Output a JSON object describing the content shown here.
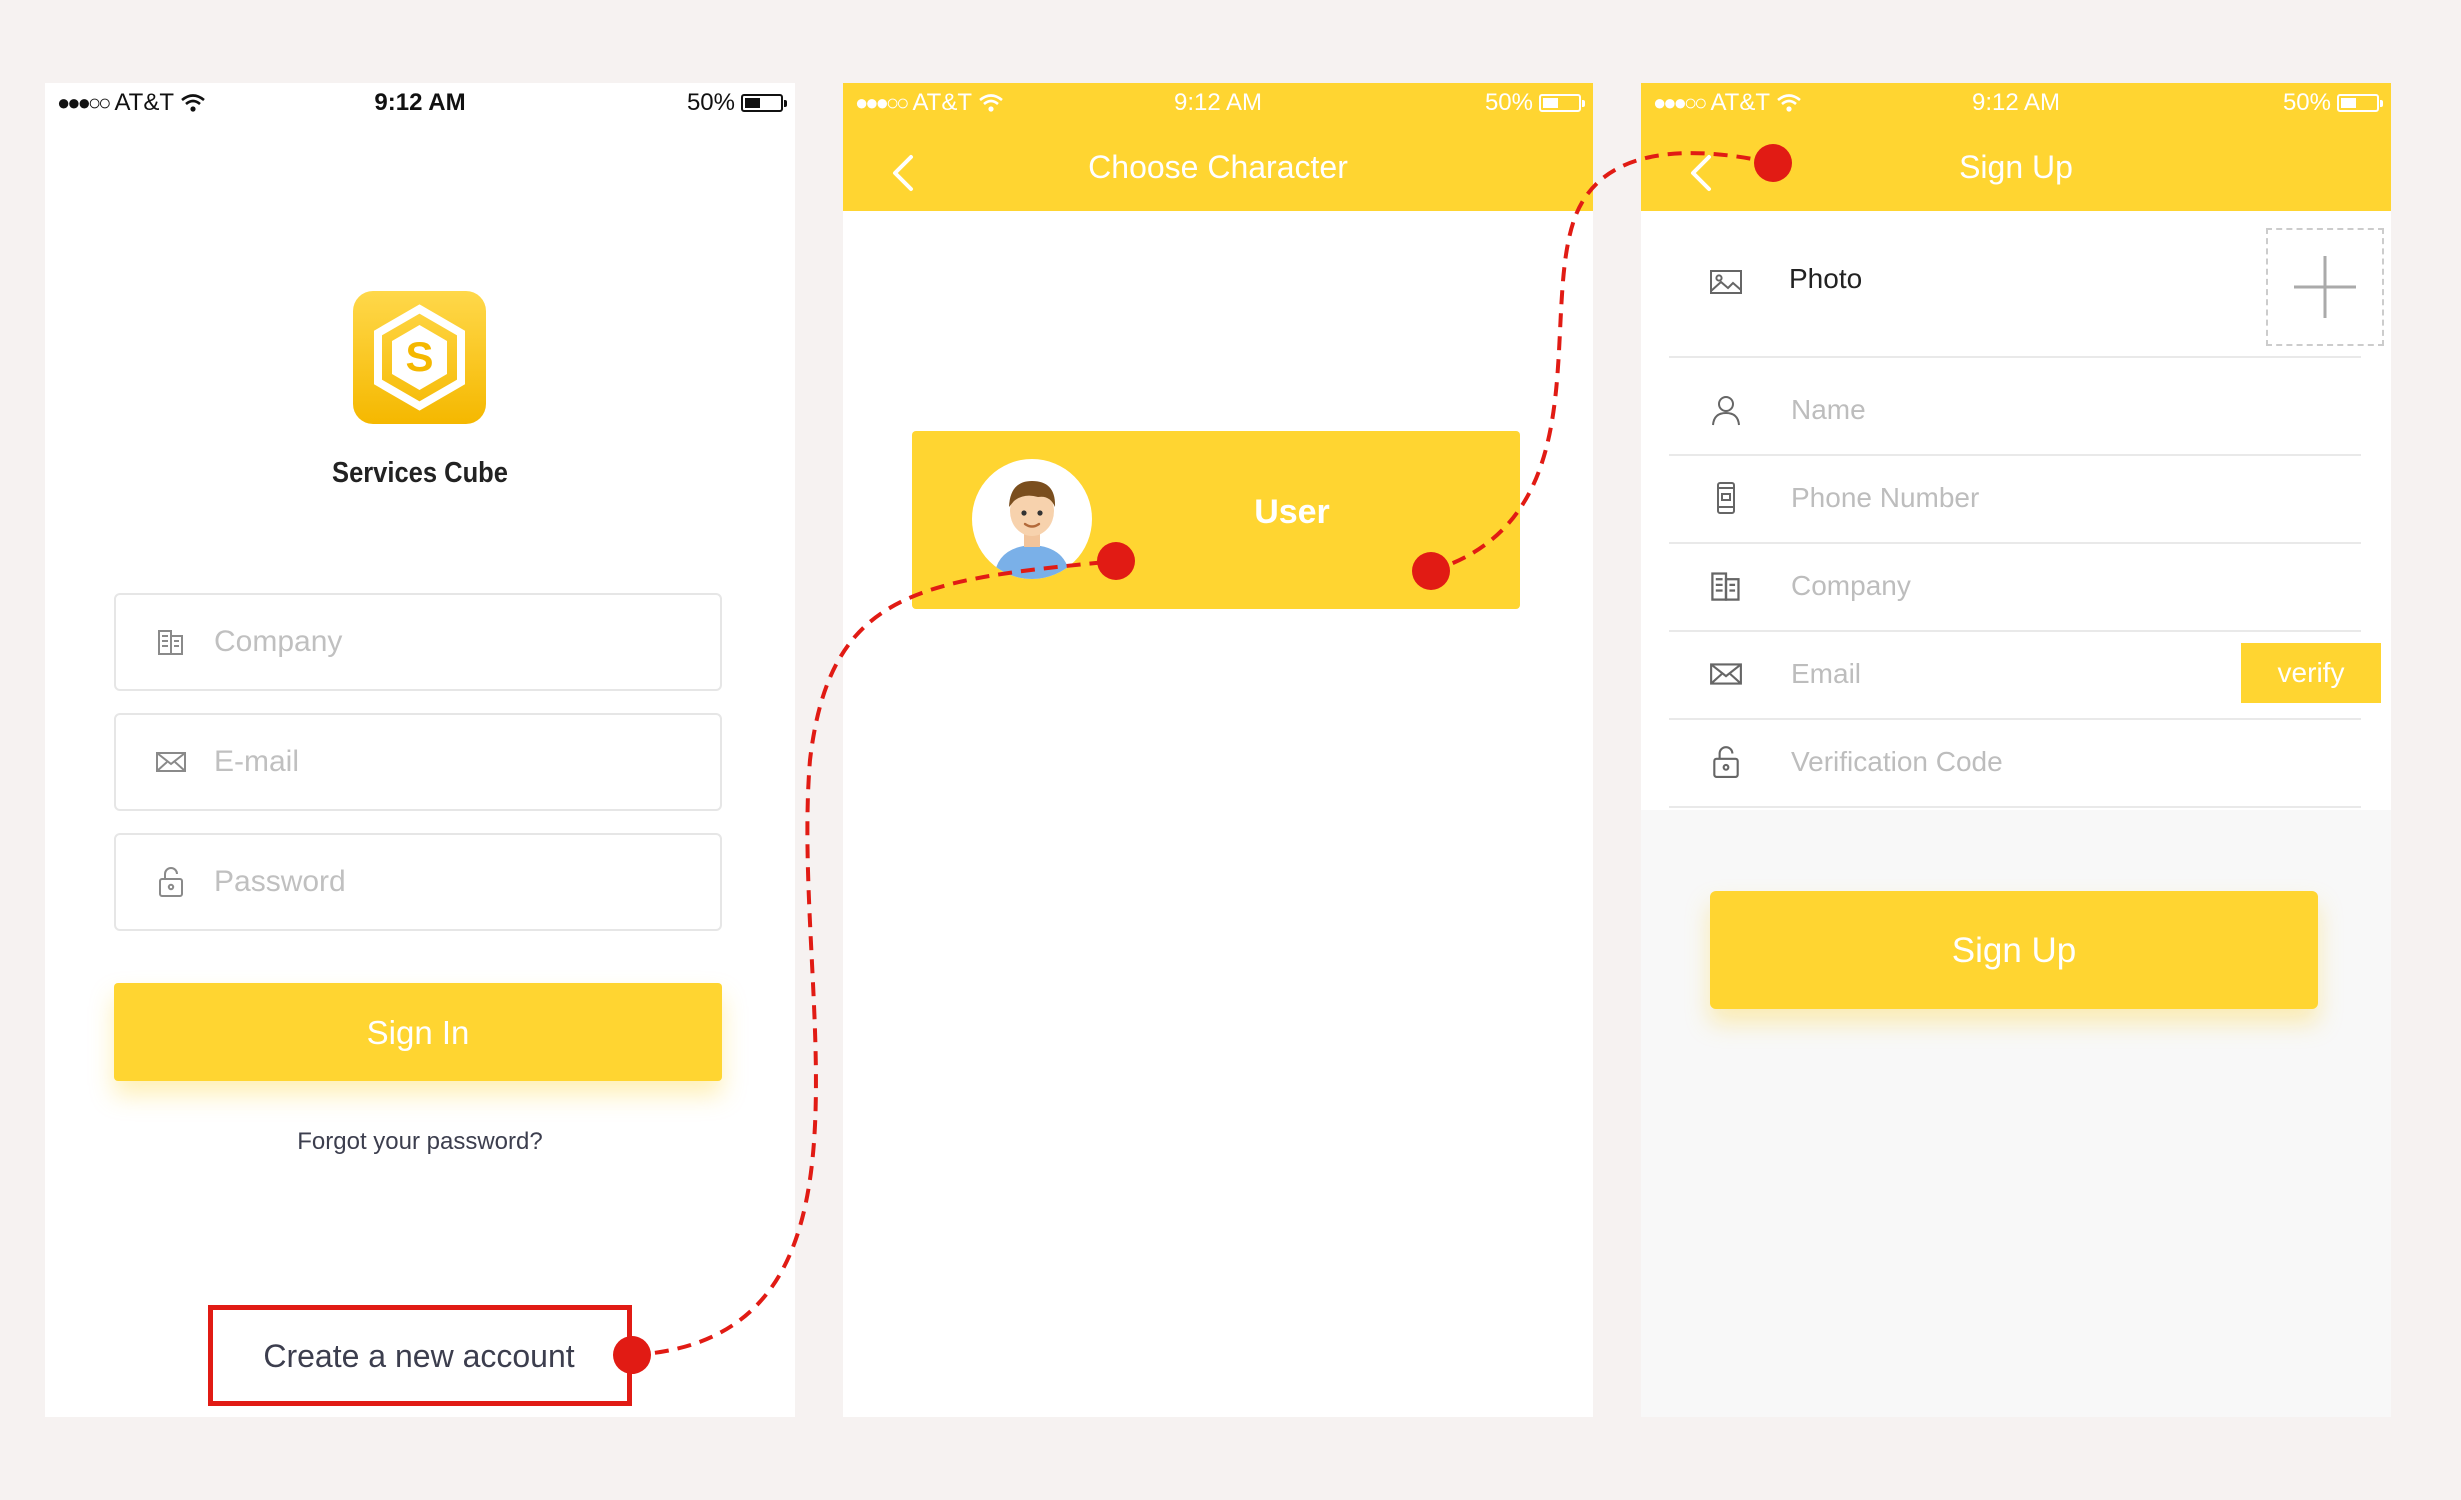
{
  "status_bar": {
    "carrier": "AT&T",
    "time": "9:12 AM",
    "battery": "50%",
    "battery_level": 0.5
  },
  "login": {
    "brand_name": "Services Cube",
    "logo_letter": "S",
    "company_placeholder": "Company",
    "email_placeholder": "E-mail",
    "password_placeholder": "Password",
    "sign_in_label": "Sign In",
    "forgot_label": "Forgot your password?",
    "create_account_label": "Create a new account",
    "icons": {
      "company": "building-icon",
      "email": "envelope-icon",
      "password": "lock-icon",
      "logo": "services-cube-logo"
    }
  },
  "choose": {
    "title": "Choose Character",
    "user_label": "User",
    "icons": {
      "back": "chevron-left-icon",
      "avatar": "user-avatar"
    }
  },
  "signup": {
    "title": "Sign Up",
    "photo_label": "Photo",
    "name_placeholder": "Name",
    "phone_placeholder": "Phone Number",
    "company_placeholder": "Company",
    "email_placeholder": "Email",
    "verify_label": "verify",
    "code_placeholder": "Verification Code",
    "sign_up_label": "Sign Up",
    "icons": {
      "photo": "image-icon",
      "add": "plus-icon",
      "name": "person-icon",
      "phone": "phone-icon",
      "company": "building-icon",
      "email": "envelope-icon",
      "code": "lock-icon"
    }
  },
  "colors": {
    "accent": "#ffd531",
    "flow": "#e11b14",
    "background": "#f6f2f1",
    "text_dark": "#3c3e4e"
  }
}
